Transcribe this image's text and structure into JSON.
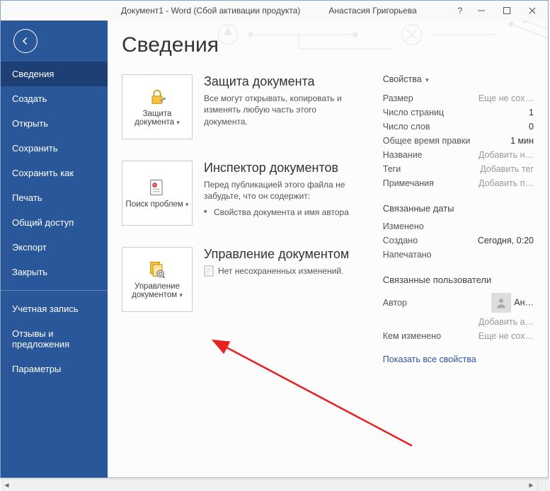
{
  "titlebar": {
    "doc": "Документ1  -  Word  (Сбой активации продукта)",
    "user": "Анастасия Григорьева",
    "help": "?"
  },
  "sidebar": {
    "items": [
      "Сведения",
      "Создать",
      "Открыть",
      "Сохранить",
      "Сохранить как",
      "Печать",
      "Общий доступ",
      "Экспорт",
      "Закрыть"
    ],
    "account": "Учетная запись",
    "feedback": "Отзывы и предложения",
    "options": "Параметры"
  },
  "main": {
    "heading": "Сведения",
    "protect": {
      "tile": "Защита документа",
      "title": "Защита документа",
      "desc": "Все могут открывать, копировать и изменять любую часть этого документа."
    },
    "inspect": {
      "tile": "Поиск проблем",
      "title": "Инспектор документов",
      "desc": "Перед публикацией этого файла не забудьте, что он содержит:",
      "bullet": "Свойства документа и имя автора"
    },
    "manage": {
      "tile": "Управление документом",
      "title": "Управление документом",
      "desc": "Нет несохраненных изменений."
    }
  },
  "props": {
    "header": "Свойства",
    "rows": [
      {
        "label": "Размер",
        "value": "Еще не сох…",
        "placeholder": true
      },
      {
        "label": "Число страниц",
        "value": "1"
      },
      {
        "label": "Число слов",
        "value": "0"
      },
      {
        "label": "Общее время правки",
        "value": "1 мин"
      },
      {
        "label": "Название",
        "value": "Добавить н…",
        "placeholder": true
      },
      {
        "label": "Теги",
        "value": "Добавить тег",
        "placeholder": true
      },
      {
        "label": "Примечания",
        "value": "Добавить п…",
        "placeholder": true
      }
    ],
    "dates_h": "Связанные даты",
    "dates": [
      {
        "label": "Изменено",
        "value": ""
      },
      {
        "label": "Создано",
        "value": "Сегодня, 0:20"
      },
      {
        "label": "Напечатано",
        "value": ""
      }
    ],
    "users_h": "Связанные пользователи",
    "author_label": "Автор",
    "author_value": "Ан…",
    "add_author": "Добавить а…",
    "changed_by_label": "Кем изменено",
    "changed_by_value": "Еще не сох…",
    "show_all": "Показать все свойства"
  }
}
